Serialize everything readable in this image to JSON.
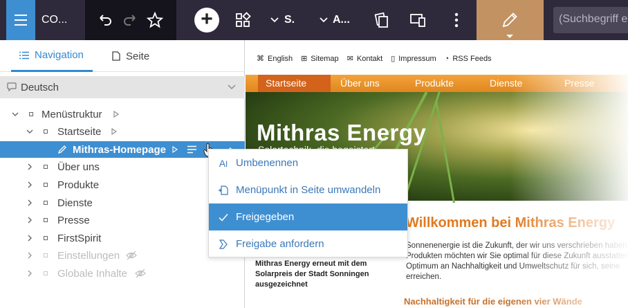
{
  "toolbar": {
    "project_label": "CO...",
    "dropdown1_label": "S.",
    "dropdown2_label": "A...",
    "search_placeholder": "(Suchbegriff eingeben)"
  },
  "tabs": {
    "navigation": "Navigation",
    "page": "Seite"
  },
  "language": "Deutsch",
  "tree": {
    "root": "Menüstruktur",
    "startseite": "Startseite",
    "selected": "Mithras-Homepage",
    "items": [
      "Über uns",
      "Produkte",
      "Dienste",
      "Presse",
      "FirstSpirit"
    ],
    "hidden_items": [
      "Einstellungen",
      "Globale Inhalte"
    ]
  },
  "context_menu": {
    "rename": "Umbenennen",
    "convert": "Menüpunkt in Seite umwandeln",
    "released": "Freigegeben",
    "request_release": "Freigabe anfordern"
  },
  "preview": {
    "meta": [
      "English",
      "Sitemap",
      "Kontakt",
      "Impressum",
      "RSS Feeds"
    ],
    "nav": [
      "Startseite",
      "Über uns",
      "Produkte",
      "Dienste",
      "Presse"
    ],
    "hero_title": "Mithras Energy",
    "hero_subtitle": "Solartechnik, die begeistert",
    "welcome": "Willkommen bei Mithras Energy",
    "intro": "Sonnenenergie ist die Zukunft, der wir uns verschrieben haben. Produkten möchten wir Sie optimal für diese Zukunft ausstatten. Optimum an Nachhaltigkeit und Umweltschutz für sich, seine erreichen.",
    "award": "Mithras Energy erneut mit dem Solarpreis der Stadt Sonningen ausgezeichnet",
    "sub_heading": "Nachhaltigkeit für die eigenen vier Wände"
  },
  "colors": {
    "accent": "#3e8fd1",
    "toolbar_bg": "#2f2a3b",
    "edit_bg": "#c39262",
    "brand_orange": "#e07a20"
  }
}
